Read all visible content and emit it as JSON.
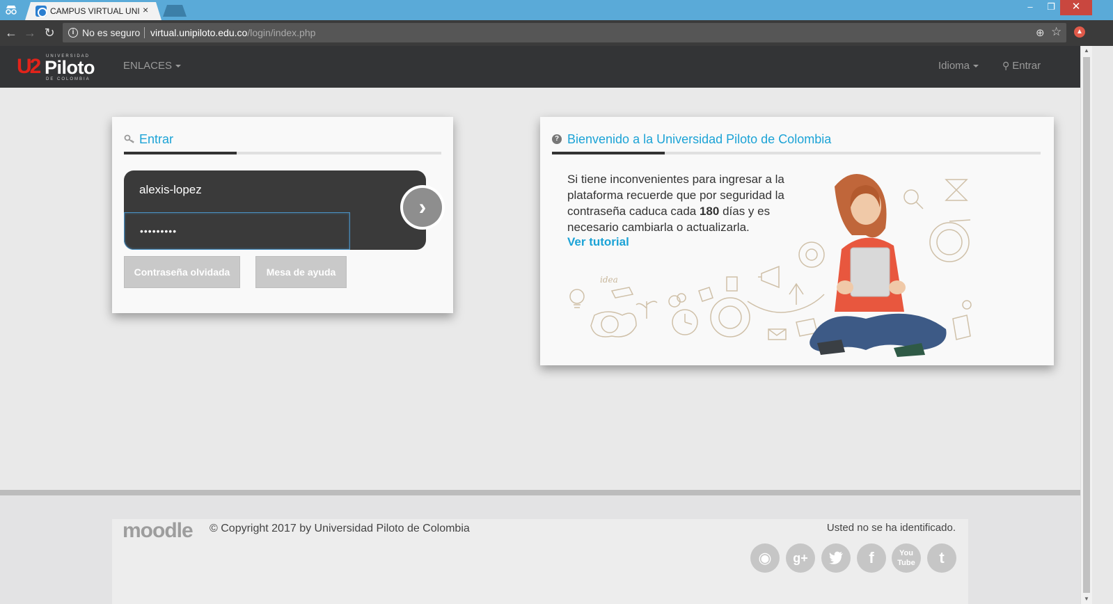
{
  "browser": {
    "tab_title": "CAMPUS VIRTUAL UNIVE",
    "tab_close": "×",
    "security_text": "No es seguro",
    "url_host": "virtual.unipiloto.edu.co",
    "url_path": "/login/index.php",
    "window_controls": {
      "minimize": "–",
      "maximize": "❐",
      "close": "✕"
    }
  },
  "navbar": {
    "logo": {
      "mark": "U2",
      "top_text": "UNIVERSIDAD",
      "name": "Piloto",
      "bottom_text": "DE COLOMBIA"
    },
    "enlaces_label": "ENLACES",
    "idioma_label": "Idioma",
    "entrar_label": "Entrar"
  },
  "login": {
    "title": "Entrar",
    "username_value": "alexis-lopez",
    "password_value": "•••••••••",
    "forgot_button": "Contraseña olvidada",
    "help_button": "Mesa de ayuda"
  },
  "welcome": {
    "title": "Bienvenido a la Universidad Piloto de Colombia",
    "text_before": "Si tiene inconvenientes para ingresar a la plataforma recuerde que por seguridad la contraseña caduca cada ",
    "text_bold": "180",
    "text_after": " días y es necesario cambiarla o actualizarla.",
    "tutorial_link": "Ver tutorial",
    "illustration_doodle": "idea"
  },
  "footer": {
    "moodle_logo": "moodle",
    "copyright": "© Copyright 2017 by Universidad Piloto de Colombia",
    "login_status": "Usted no se ha identificado.",
    "social": [
      "web",
      "google-plus",
      "twitter",
      "facebook",
      "youtube",
      "tumblr"
    ],
    "youtube_label": "You Tube"
  },
  "colors": {
    "accent": "#1ca3d6",
    "navbar": "#333436",
    "brand_red": "#e2231a",
    "titlebar": "#5aaad8"
  }
}
